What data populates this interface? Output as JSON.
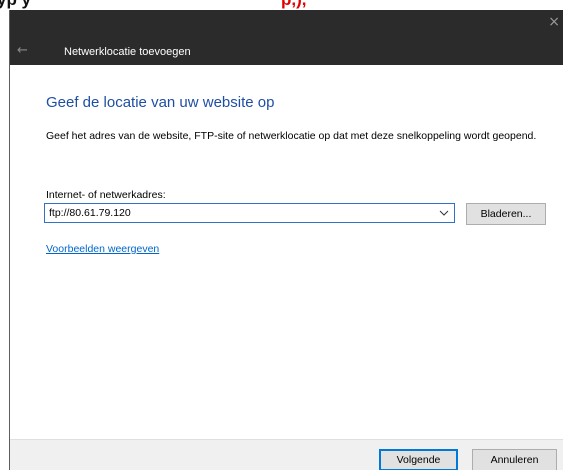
{
  "background_text": {
    "dark": "yp  y",
    "red": "p,),"
  },
  "dialog": {
    "close_glyph": "×",
    "back_glyph": "←",
    "title": "Netwerklocatie toevoegen",
    "heading": "Geef de locatie van uw website op",
    "description": "Geef het adres van de website, FTP-site of netwerklocatie op dat met deze snelkoppeling wordt geopend.",
    "address_label": "Internet- of netwerkadres:",
    "address_value": "ftp://80.61.79.120",
    "browse_label": "Bladeren...",
    "examples_link": "Voorbeelden weergeven",
    "next_label": "Volgende",
    "cancel_label": "Annuleren"
  },
  "colors": {
    "titlebar": "#2b2b2b",
    "heading": "#1f4fa3",
    "link": "#0066cc",
    "focus_border": "#2f72c6",
    "default_button_border": "#0078d7"
  }
}
